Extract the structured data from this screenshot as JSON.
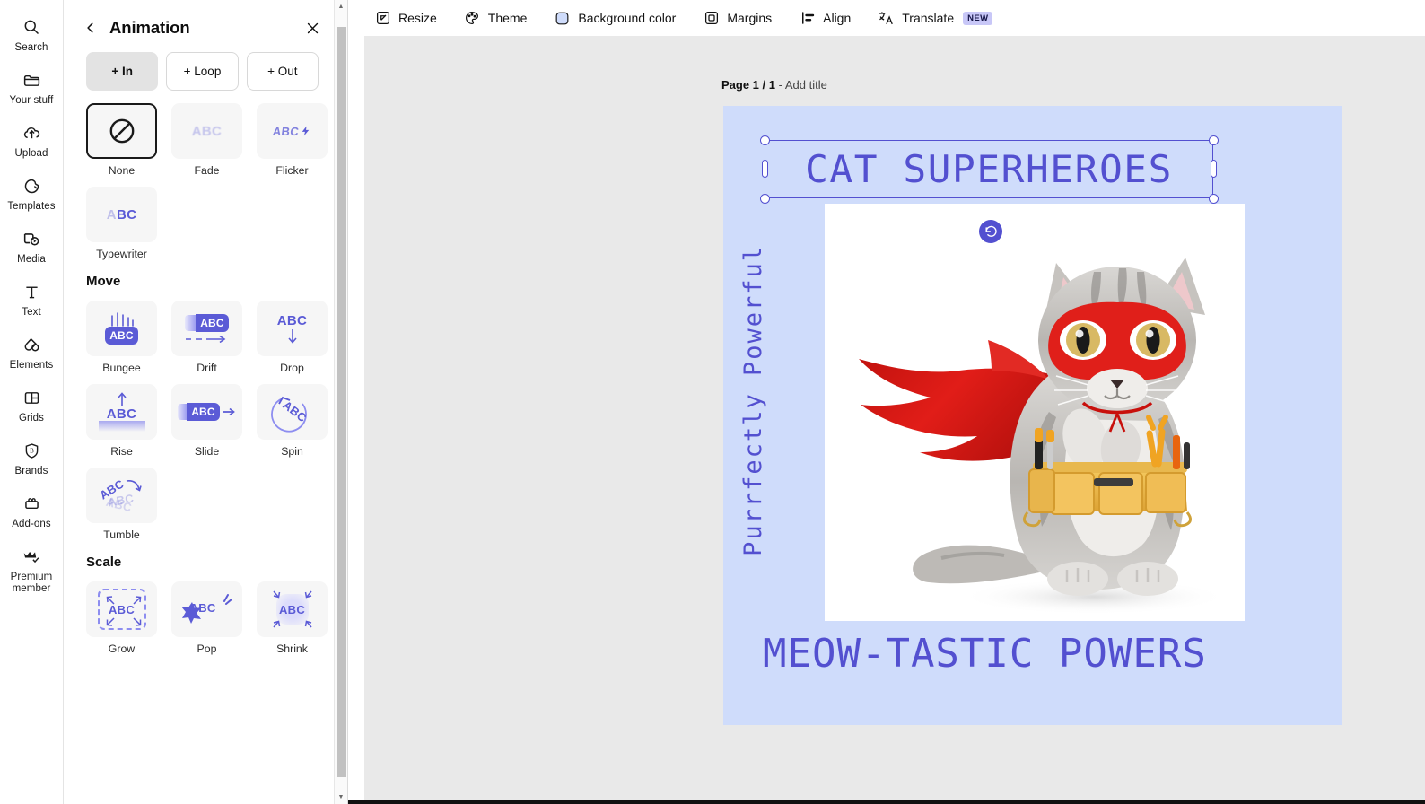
{
  "app": {
    "name": "Design editor"
  },
  "rail": {
    "items": [
      {
        "label": "Search",
        "icon": "search-icon"
      },
      {
        "label": "Your stuff",
        "icon": "folder-icon"
      },
      {
        "label": "Upload",
        "icon": "upload-cloud-icon"
      },
      {
        "label": "Templates",
        "icon": "templates-icon"
      },
      {
        "label": "Media",
        "icon": "media-icon"
      },
      {
        "label": "Text",
        "icon": "text-icon"
      },
      {
        "label": "Elements",
        "icon": "elements-icon"
      },
      {
        "label": "Grids",
        "icon": "grids-icon"
      },
      {
        "label": "Brands",
        "icon": "brands-icon"
      },
      {
        "label": "Add-ons",
        "icon": "addons-icon"
      },
      {
        "label": "Premium\nmember",
        "icon": "crown-check-icon"
      }
    ]
  },
  "panel": {
    "title": "Animation",
    "back_icon": "chevron-left-icon",
    "close_icon": "close-icon",
    "tabs": [
      {
        "label": "+ In",
        "active": true
      },
      {
        "label": "+ Loop",
        "active": false
      },
      {
        "label": "+ Out",
        "active": false
      }
    ],
    "sections": [
      {
        "heading": "",
        "items": [
          {
            "label": "None",
            "selected": true,
            "preview": "no-entry-icon"
          },
          {
            "label": "Fade",
            "selected": false,
            "preview": "abc-faded"
          },
          {
            "label": "Flicker",
            "selected": false,
            "preview": "abc-bolt"
          },
          {
            "label": "Typewriter",
            "selected": false,
            "preview": "abc-typewriter"
          }
        ]
      },
      {
        "heading": "Move",
        "items": [
          {
            "label": "Bungee",
            "selected": false,
            "preview": "abc-bungee"
          },
          {
            "label": "Drift",
            "selected": false,
            "preview": "abc-drift"
          },
          {
            "label": "Drop",
            "selected": false,
            "preview": "abc-drop"
          },
          {
            "label": "Rise",
            "selected": false,
            "preview": "abc-rise"
          },
          {
            "label": "Slide",
            "selected": false,
            "preview": "abc-slide"
          },
          {
            "label": "Spin",
            "selected": false,
            "preview": "abc-spin"
          },
          {
            "label": "Tumble",
            "selected": false,
            "preview": "abc-tumble"
          }
        ]
      },
      {
        "heading": "Scale",
        "items": [
          {
            "label": "Grow",
            "selected": false,
            "preview": "abc-grow"
          },
          {
            "label": "Pop",
            "selected": false,
            "preview": "abc-pop"
          },
          {
            "label": "Shrink",
            "selected": false,
            "preview": "abc-shrink"
          }
        ]
      }
    ]
  },
  "toolbar": {
    "items": [
      {
        "label": "Resize",
        "icon": "resize-icon",
        "badge": ""
      },
      {
        "label": "Theme",
        "icon": "palette-icon",
        "badge": ""
      },
      {
        "label": "Background color",
        "icon": "background-color-icon",
        "badge": ""
      },
      {
        "label": "Margins",
        "icon": "margins-icon",
        "badge": ""
      },
      {
        "label": "Align",
        "icon": "align-icon",
        "badge": ""
      },
      {
        "label": "Translate",
        "icon": "translate-icon",
        "badge": "NEW"
      }
    ]
  },
  "canvas": {
    "page_label_prefix": "Page 1 / 1",
    "page_label_suffix": "- Add title",
    "background_color": "#cfdcfb",
    "accent_color": "#5350d0",
    "title_text": "CAT SUPERHEROES",
    "vertical_text": "Purrfectly Powerful",
    "subtitle_text": "MEOW-TASTIC POWERS",
    "rotate_icon": "rotate-left-icon",
    "image_alt": "Gray tabby kitten wearing a red superhero mask and cape with a yellow tool belt"
  }
}
